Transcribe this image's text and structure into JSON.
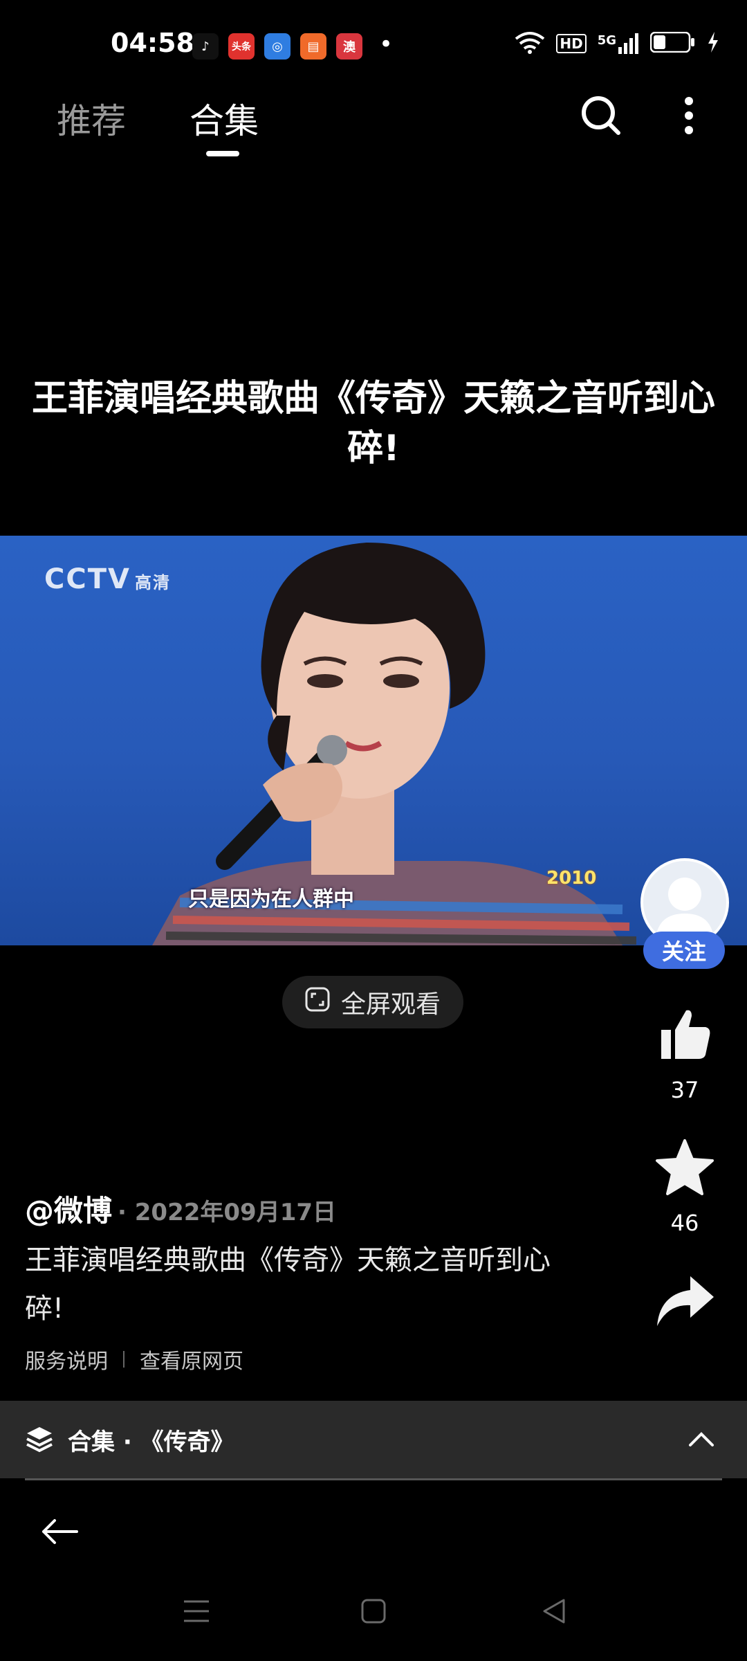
{
  "status_bar": {
    "time": "04:58",
    "notifications": [
      {
        "icon": "tiktok-icon",
        "color": "#111111",
        "text": "♪"
      },
      {
        "icon": "toutiao-icon",
        "color": "#e0322e",
        "text": "头条"
      },
      {
        "icon": "browser-icon",
        "color": "#2f7de1",
        "text": "◎"
      },
      {
        "icon": "reader-icon",
        "color": "#f06a2a",
        "text": "▤"
      },
      {
        "icon": "news-icon",
        "color": "#d9363e",
        "text": "澳"
      }
    ],
    "dot": "•",
    "hd_label": "HD",
    "network_label": "5G",
    "battery_level": 0.35
  },
  "tabs": [
    {
      "label": "推荐",
      "active": false
    },
    {
      "label": "合集",
      "active": true
    }
  ],
  "video": {
    "title": "王菲演唱经典歌曲《传奇》天籁之音听到心碎!",
    "channel_logo": "CCTV",
    "channel_quality": "高清",
    "subtitle": "只是因为在人群中",
    "badge_year": "2010"
  },
  "fullscreen_label": "全屏观看",
  "rail": {
    "follow_label": "关注",
    "likes": "37",
    "favorites": "46"
  },
  "post": {
    "author": "@微博",
    "date_sep": "·",
    "date": "2022年09月17日",
    "description": "王菲演唱经典歌曲《传奇》天籁之音听到心碎!",
    "service_link": "服务说明",
    "source_link": "查看原网页"
  },
  "collection": {
    "label": "合集 · 《传奇》"
  },
  "colors": {
    "accent": "#3f6de0",
    "video_bg": "#2759b7"
  }
}
